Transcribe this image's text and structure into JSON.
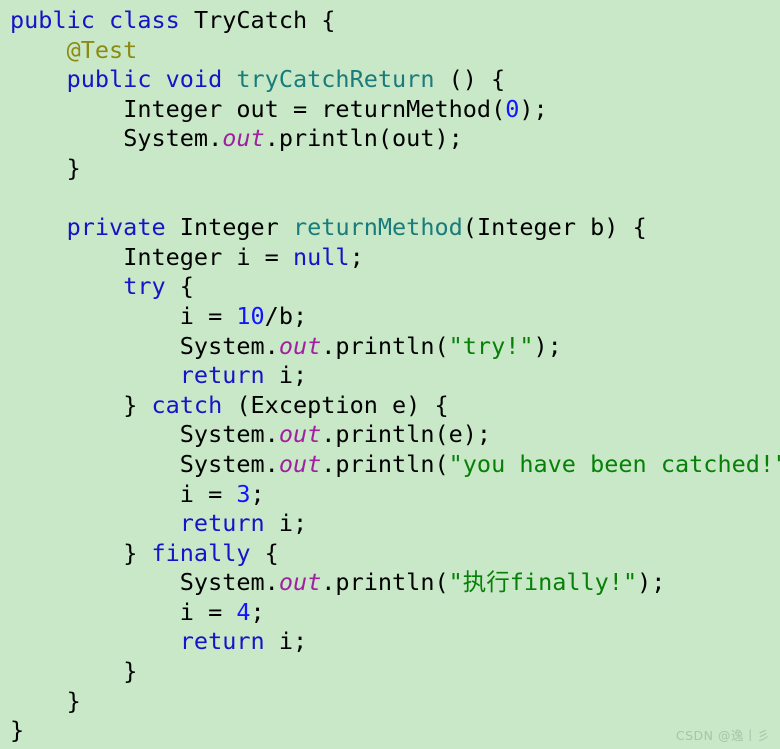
{
  "editor": {
    "background_color": "#c8e8c8",
    "language": "java",
    "font_size_px": 23.5,
    "line_height_px": 29.6
  },
  "palette": {
    "keyword": "#1414c8",
    "annotation": "#8b8b14",
    "type": "#000000",
    "method": "#1a7b7b",
    "number": "#1414ff",
    "string": "#068006",
    "field": "#a020a0",
    "plain": "#000000",
    "watermark": "#a9c4a9"
  },
  "watermark": {
    "text": "CSDN @逸丨彡"
  },
  "code": {
    "lines": [
      {
        "id": 1,
        "indent": 0,
        "tokens": [
          {
            "t": "public",
            "c": "kw"
          },
          {
            "t": " ",
            "c": "plain"
          },
          {
            "t": "class",
            "c": "kw"
          },
          {
            "t": " ",
            "c": "plain"
          },
          {
            "t": "TryCatch",
            "c": "type"
          },
          {
            "t": " {",
            "c": "plain"
          }
        ]
      },
      {
        "id": 2,
        "indent": 1,
        "tokens": [
          {
            "t": "@Test",
            "c": "ann"
          }
        ]
      },
      {
        "id": 3,
        "indent": 1,
        "tokens": [
          {
            "t": "public",
            "c": "kw"
          },
          {
            "t": " ",
            "c": "plain"
          },
          {
            "t": "void",
            "c": "kw"
          },
          {
            "t": " ",
            "c": "plain"
          },
          {
            "t": "tryCatchReturn",
            "c": "method"
          },
          {
            "t": " () {",
            "c": "plain"
          }
        ]
      },
      {
        "id": 4,
        "indent": 2,
        "tokens": [
          {
            "t": "Integer",
            "c": "type"
          },
          {
            "t": " out = ",
            "c": "plain"
          },
          {
            "t": "returnMethod",
            "c": "plain"
          },
          {
            "t": "(",
            "c": "plain"
          },
          {
            "t": "0",
            "c": "num"
          },
          {
            "t": ");",
            "c": "plain"
          }
        ]
      },
      {
        "id": 5,
        "indent": 2,
        "tokens": [
          {
            "t": "System.",
            "c": "plain"
          },
          {
            "t": "out",
            "c": "field"
          },
          {
            "t": ".println(out);",
            "c": "plain"
          }
        ]
      },
      {
        "id": 6,
        "indent": 1,
        "tokens": [
          {
            "t": "}",
            "c": "plain"
          }
        ]
      },
      {
        "id": 7,
        "indent": 0,
        "tokens": []
      },
      {
        "id": 8,
        "indent": 1,
        "tokens": [
          {
            "t": "private",
            "c": "kw"
          },
          {
            "t": " ",
            "c": "plain"
          },
          {
            "t": "Integer",
            "c": "type"
          },
          {
            "t": " ",
            "c": "plain"
          },
          {
            "t": "returnMethod",
            "c": "method"
          },
          {
            "t": "(",
            "c": "plain"
          },
          {
            "t": "Integer",
            "c": "type"
          },
          {
            "t": " b) {",
            "c": "plain"
          }
        ]
      },
      {
        "id": 9,
        "indent": 2,
        "tokens": [
          {
            "t": "Integer",
            "c": "type"
          },
          {
            "t": " i = ",
            "c": "plain"
          },
          {
            "t": "null",
            "c": "kw"
          },
          {
            "t": ";",
            "c": "plain"
          }
        ]
      },
      {
        "id": 10,
        "indent": 2,
        "tokens": [
          {
            "t": "try",
            "c": "kw"
          },
          {
            "t": " {",
            "c": "plain"
          }
        ]
      },
      {
        "id": 11,
        "indent": 3,
        "tokens": [
          {
            "t": "i = ",
            "c": "plain"
          },
          {
            "t": "10",
            "c": "num"
          },
          {
            "t": "/b;",
            "c": "plain"
          }
        ]
      },
      {
        "id": 12,
        "indent": 3,
        "tokens": [
          {
            "t": "System.",
            "c": "plain"
          },
          {
            "t": "out",
            "c": "field"
          },
          {
            "t": ".println(",
            "c": "plain"
          },
          {
            "t": "\"try!\"",
            "c": "str"
          },
          {
            "t": ");",
            "c": "plain"
          }
        ]
      },
      {
        "id": 13,
        "indent": 3,
        "tokens": [
          {
            "t": "return",
            "c": "kw"
          },
          {
            "t": " i;",
            "c": "plain"
          }
        ]
      },
      {
        "id": 14,
        "indent": 2,
        "tokens": [
          {
            "t": "} ",
            "c": "plain"
          },
          {
            "t": "catch",
            "c": "kw"
          },
          {
            "t": " (",
            "c": "plain"
          },
          {
            "t": "Exception",
            "c": "type"
          },
          {
            "t": " e) {",
            "c": "plain"
          }
        ]
      },
      {
        "id": 15,
        "indent": 3,
        "tokens": [
          {
            "t": "System.",
            "c": "plain"
          },
          {
            "t": "out",
            "c": "field"
          },
          {
            "t": ".println(e);",
            "c": "plain"
          }
        ]
      },
      {
        "id": 16,
        "indent": 3,
        "tokens": [
          {
            "t": "System.",
            "c": "plain"
          },
          {
            "t": "out",
            "c": "field"
          },
          {
            "t": ".println(",
            "c": "plain"
          },
          {
            "t": "\"you have been catched!\"",
            "c": "str"
          },
          {
            "t": ");",
            "c": "plain"
          }
        ]
      },
      {
        "id": 17,
        "indent": 3,
        "tokens": [
          {
            "t": "i = ",
            "c": "plain"
          },
          {
            "t": "3",
            "c": "num"
          },
          {
            "t": ";",
            "c": "plain"
          }
        ]
      },
      {
        "id": 18,
        "indent": 3,
        "tokens": [
          {
            "t": "return",
            "c": "kw"
          },
          {
            "t": " i;",
            "c": "plain"
          }
        ]
      },
      {
        "id": 19,
        "indent": 2,
        "tokens": [
          {
            "t": "} ",
            "c": "plain"
          },
          {
            "t": "finally",
            "c": "kw"
          },
          {
            "t": " {",
            "c": "plain"
          }
        ]
      },
      {
        "id": 20,
        "indent": 3,
        "tokens": [
          {
            "t": "System.",
            "c": "plain"
          },
          {
            "t": "out",
            "c": "field"
          },
          {
            "t": ".println(",
            "c": "plain"
          },
          {
            "t": "\"执行finally!\"",
            "c": "str"
          },
          {
            "t": ");",
            "c": "plain"
          }
        ]
      },
      {
        "id": 21,
        "indent": 3,
        "tokens": [
          {
            "t": "i = ",
            "c": "plain"
          },
          {
            "t": "4",
            "c": "num"
          },
          {
            "t": ";",
            "c": "plain"
          }
        ]
      },
      {
        "id": 22,
        "indent": 3,
        "tokens": [
          {
            "t": "return",
            "c": "kw"
          },
          {
            "t": " i;",
            "c": "plain"
          }
        ]
      },
      {
        "id": 23,
        "indent": 2,
        "tokens": [
          {
            "t": "}",
            "c": "plain"
          }
        ]
      },
      {
        "id": 24,
        "indent": 1,
        "tokens": [
          {
            "t": "}",
            "c": "plain"
          }
        ]
      },
      {
        "id": 25,
        "indent": 0,
        "tokens": [
          {
            "t": "}",
            "c": "plain"
          }
        ]
      }
    ]
  }
}
